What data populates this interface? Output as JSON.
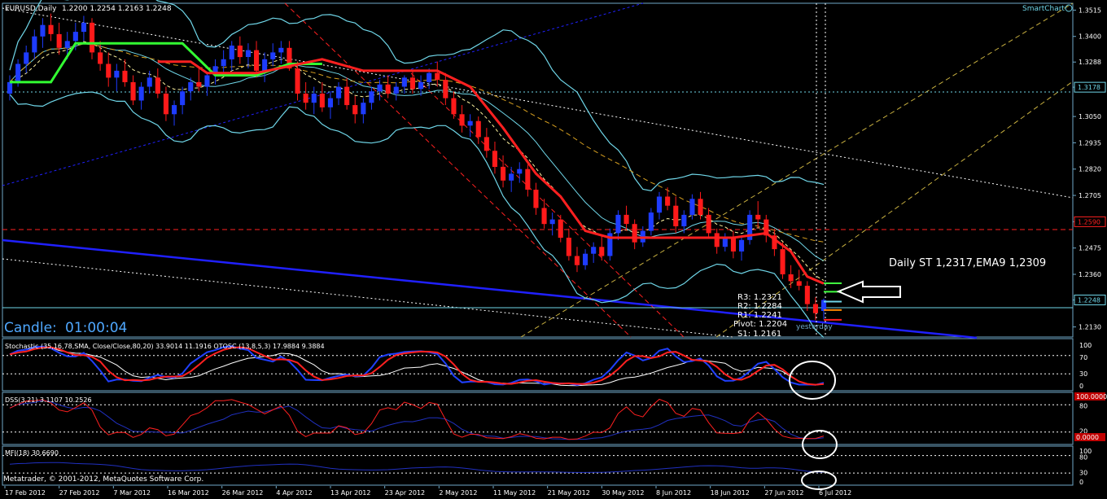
{
  "window": {
    "title": "EURUSD,Daily",
    "ohlc": "1.2200 1.2254 1.2163 1.2248",
    "smartchart": "SmartChart",
    "candle_label": "Candle:",
    "candle_time": "01:00:04",
    "annotation": "Daily ST  1,2317,EMA9 1,2309",
    "yesterday": "yesterday",
    "copyright": "Metatrader, © 2001-2012, MetaQuotes Software Corp."
  },
  "colors": {
    "bg": "#000000",
    "frame": "#6fa8c8",
    "text": "#ffffff",
    "bull": "#1e3cff",
    "bear": "#ff1a1a",
    "supertrend_up": "#32ff32",
    "supertrend_down": "#ff2020",
    "bands": "#6fd6e8",
    "trendline": "#2020ff"
  },
  "pivots": [
    {
      "label": "R3: 1.2321",
      "value": 1.2321
    },
    {
      "label": "R2: 1.2284",
      "value": 1.2284
    },
    {
      "label": "R1: 1.2241",
      "value": 1.2241
    },
    {
      "label": "Pivot: 1.2204",
      "value": 1.2204
    },
    {
      "label": "S1: 1.2161",
      "value": 1.2161
    }
  ],
  "indicators": {
    "stoch": {
      "label": "Stochastic (35,16,78,SMA, Close/Close,80,20) 33.9014 11.1916  OTOSC (13,8,5,3) 17.9884 9.3884",
      "ticks": [
        "100",
        "70",
        "30",
        "0"
      ]
    },
    "dss": {
      "label": "DSS(3,21) 3.1107 10.2526",
      "ticks": [
        "80",
        "20"
      ],
      "badges": [
        "100.0000",
        "0.0000"
      ]
    },
    "mfi": {
      "label": "MFI(18) 30.6690",
      "ticks": [
        "100",
        "80",
        "30",
        "0"
      ]
    }
  },
  "chart_data": {
    "type": "candlestick",
    "symbol": "EURUSD",
    "timeframe": "Daily",
    "ylim": [
      1.2086,
      1.3545
    ],
    "y_ticks": [
      "1.3515",
      "1.3400",
      "1.3288",
      "1.3178",
      "1.3050",
      "1.2935",
      "1.2820",
      "1.2705",
      "1.2590",
      "1.2475",
      "1.2360",
      "1.2248",
      "1.2130"
    ],
    "price_labels": [
      {
        "text": "1.3178",
        "value": 1.3178
      },
      {
        "text": "1.2590",
        "value": 1.259
      },
      {
        "text": "1.2248",
        "value": 1.2248
      }
    ],
    "x_ticks": [
      "17 Feb 2012",
      "27 Feb 2012",
      "7 Mar 2012",
      "16 Mar 2012",
      "26 Mar 2012",
      "4 Apr 2012",
      "13 Apr 2012",
      "23 Apr 2012",
      "2 May 2012",
      "11 May 2012",
      "21 May 2012",
      "30 May 2012",
      "8 Jun 2012",
      "18 Jun 2012",
      "27 Jun 2012",
      "6 Jul 2012"
    ],
    "ohlc": [
      [
        1.315,
        1.323,
        1.312,
        1.32
      ],
      [
        1.32,
        1.33,
        1.318,
        1.328
      ],
      [
        1.328,
        1.336,
        1.324,
        1.333
      ],
      [
        1.333,
        1.343,
        1.33,
        1.34
      ],
      [
        1.34,
        1.348,
        1.335,
        1.345
      ],
      [
        1.345,
        1.35,
        1.338,
        1.341
      ],
      [
        1.341,
        1.346,
        1.332,
        1.335
      ],
      [
        1.335,
        1.342,
        1.33,
        1.338
      ],
      [
        1.338,
        1.346,
        1.334,
        1.342
      ],
      [
        1.342,
        1.349,
        1.338,
        1.346
      ],
      [
        1.346,
        1.348,
        1.33,
        1.333
      ],
      [
        1.333,
        1.338,
        1.325,
        1.328
      ],
      [
        1.328,
        1.333,
        1.318,
        1.322
      ],
      [
        1.322,
        1.328,
        1.316,
        1.325
      ],
      [
        1.325,
        1.33,
        1.318,
        1.32
      ],
      [
        1.32,
        1.323,
        1.31,
        1.312
      ],
      [
        1.312,
        1.32,
        1.308,
        1.318
      ],
      [
        1.318,
        1.325,
        1.315,
        1.322
      ],
      [
        1.322,
        1.326,
        1.313,
        1.315
      ],
      [
        1.315,
        1.318,
        1.303,
        1.306
      ],
      [
        1.306,
        1.312,
        1.301,
        1.31
      ],
      [
        1.31,
        1.318,
        1.306,
        1.316
      ],
      [
        1.316,
        1.322,
        1.312,
        1.32
      ],
      [
        1.32,
        1.326,
        1.316,
        1.318
      ],
      [
        1.318,
        1.324,
        1.314,
        1.323
      ],
      [
        1.323,
        1.33,
        1.319,
        1.327
      ],
      [
        1.327,
        1.334,
        1.323,
        1.33
      ],
      [
        1.33,
        1.338,
        1.325,
        1.336
      ],
      [
        1.336,
        1.34,
        1.328,
        1.331
      ],
      [
        1.331,
        1.337,
        1.326,
        1.334
      ],
      [
        1.334,
        1.338,
        1.322,
        1.325
      ],
      [
        1.325,
        1.333,
        1.32,
        1.33
      ],
      [
        1.33,
        1.337,
        1.327,
        1.333
      ],
      [
        1.333,
        1.338,
        1.328,
        1.335
      ],
      [
        1.335,
        1.338,
        1.325,
        1.326
      ],
      [
        1.326,
        1.329,
        1.312,
        1.315
      ],
      [
        1.315,
        1.32,
        1.308,
        1.311
      ],
      [
        1.311,
        1.318,
        1.306,
        1.315
      ],
      [
        1.315,
        1.32,
        1.307,
        1.309
      ],
      [
        1.309,
        1.316,
        1.304,
        1.313
      ],
      [
        1.313,
        1.32,
        1.31,
        1.318
      ],
      [
        1.318,
        1.322,
        1.308,
        1.31
      ],
      [
        1.31,
        1.314,
        1.302,
        1.306
      ],
      [
        1.306,
        1.313,
        1.302,
        1.311
      ],
      [
        1.311,
        1.318,
        1.308,
        1.316
      ],
      [
        1.316,
        1.321,
        1.312,
        1.319
      ],
      [
        1.319,
        1.323,
        1.313,
        1.315
      ],
      [
        1.315,
        1.32,
        1.312,
        1.318
      ],
      [
        1.318,
        1.323,
        1.315,
        1.322
      ],
      [
        1.322,
        1.325,
        1.315,
        1.317
      ],
      [
        1.317,
        1.323,
        1.314,
        1.32
      ],
      [
        1.32,
        1.326,
        1.317,
        1.324
      ],
      [
        1.324,
        1.329,
        1.318,
        1.321
      ],
      [
        1.321,
        1.324,
        1.31,
        1.313
      ],
      [
        1.313,
        1.316,
        1.304,
        1.306
      ],
      [
        1.306,
        1.31,
        1.298,
        1.301
      ],
      [
        1.301,
        1.306,
        1.296,
        1.303
      ],
      [
        1.303,
        1.305,
        1.293,
        1.296
      ],
      [
        1.296,
        1.3,
        1.287,
        1.29
      ],
      [
        1.29,
        1.294,
        1.28,
        1.283
      ],
      [
        1.283,
        1.288,
        1.274,
        1.277
      ],
      [
        1.277,
        1.283,
        1.272,
        1.28
      ],
      [
        1.28,
        1.285,
        1.276,
        1.282
      ],
      [
        1.282,
        1.284,
        1.27,
        1.273
      ],
      [
        1.273,
        1.276,
        1.262,
        1.265
      ],
      [
        1.265,
        1.269,
        1.256,
        1.258
      ],
      [
        1.258,
        1.263,
        1.253,
        1.26
      ],
      [
        1.26,
        1.262,
        1.25,
        1.252
      ],
      [
        1.252,
        1.256,
        1.242,
        1.244
      ],
      [
        1.244,
        1.248,
        1.237,
        1.24
      ],
      [
        1.24,
        1.247,
        1.238,
        1.245
      ],
      [
        1.245,
        1.25,
        1.241,
        1.248
      ],
      [
        1.248,
        1.253,
        1.242,
        1.244
      ],
      [
        1.244,
        1.256,
        1.242,
        1.254
      ],
      [
        1.254,
        1.264,
        1.251,
        1.262
      ],
      [
        1.262,
        1.266,
        1.255,
        1.258
      ],
      [
        1.258,
        1.26,
        1.247,
        1.25
      ],
      [
        1.25,
        1.257,
        1.248,
        1.255
      ],
      [
        1.255,
        1.265,
        1.253,
        1.263
      ],
      [
        1.263,
        1.272,
        1.26,
        1.27
      ],
      [
        1.27,
        1.274,
        1.264,
        1.266
      ],
      [
        1.266,
        1.27,
        1.254,
        1.257
      ],
      [
        1.257,
        1.264,
        1.254,
        1.262
      ],
      [
        1.262,
        1.271,
        1.26,
        1.269
      ],
      [
        1.269,
        1.272,
        1.26,
        1.262
      ],
      [
        1.262,
        1.265,
        1.252,
        1.254
      ],
      [
        1.254,
        1.256,
        1.245,
        1.248
      ],
      [
        1.248,
        1.254,
        1.246,
        1.252
      ],
      [
        1.252,
        1.255,
        1.243,
        1.246
      ],
      [
        1.246,
        1.253,
        1.242,
        1.251
      ],
      [
        1.251,
        1.264,
        1.249,
        1.262
      ],
      [
        1.262,
        1.268,
        1.256,
        1.26
      ],
      [
        1.26,
        1.262,
        1.25,
        1.253
      ],
      [
        1.253,
        1.256,
        1.244,
        1.247
      ],
      [
        1.247,
        1.25,
        1.234,
        1.236
      ],
      [
        1.236,
        1.24,
        1.23,
        1.233
      ],
      [
        1.233,
        1.238,
        1.229,
        1.231
      ],
      [
        1.231,
        1.233,
        1.22,
        1.223
      ],
      [
        1.223,
        1.226,
        1.216,
        1.219
      ],
      [
        1.22,
        1.2254,
        1.2163,
        1.2248
      ]
    ],
    "supertrend_green": [
      [
        0,
        1.32
      ],
      [
        5,
        1.32
      ],
      [
        8,
        1.337
      ],
      [
        21,
        1.337
      ],
      [
        25,
        1.323
      ],
      [
        30,
        1.323
      ],
      [
        34,
        1.328
      ],
      [
        38,
        1.328
      ]
    ],
    "supertrend_red": [
      [
        18,
        1.329
      ],
      [
        22,
        1.329
      ],
      [
        24,
        1.324
      ],
      [
        30,
        1.324
      ],
      [
        38,
        1.33
      ],
      [
        43,
        1.325
      ],
      [
        52,
        1.325
      ],
      [
        56,
        1.318
      ],
      [
        60,
        1.3
      ],
      [
        64,
        1.28
      ],
      [
        67,
        1.27
      ],
      [
        70,
        1.255
      ],
      [
        73,
        1.252
      ],
      [
        88,
        1.252
      ],
      [
        92,
        1.254
      ],
      [
        95,
        1.246
      ],
      [
        97,
        1.235
      ],
      [
        99,
        1.232
      ]
    ]
  }
}
